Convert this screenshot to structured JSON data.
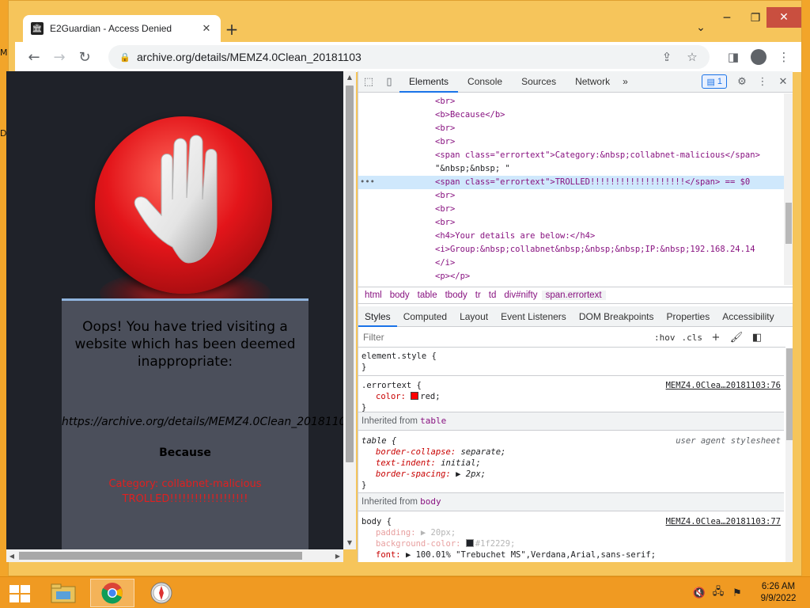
{
  "browser": {
    "tab_title": "E2Guardian - Access Denied",
    "tab_favicon": "museum-icon",
    "url": "archive.org/details/MEMZ4.0Clean_20181103"
  },
  "page": {
    "heading": "Oops! You have tried visiting a website which has been deemed inappropriate:",
    "blocked_url": "https://archive.org/details/MEMZ4.0Clean_20181103",
    "because": "Because",
    "category_line": "Category: collabnet-malicious",
    "reason_line": "TROLLED!!!!!!!!!!!!!!!!!!!"
  },
  "devtools": {
    "tabs": [
      "Elements",
      "Console",
      "Sources",
      "Network"
    ],
    "more_tabs": "»",
    "issues_count": "1",
    "elements": [
      "<br>",
      "<b>Because</b>",
      "<br>",
      "<br>",
      "<span class=\"errortext\">Category:&nbsp;collabnet-malicious</span>",
      "\"&nbsp;&nbsp; \"",
      "<span class=\"errortext\">TROLLED!!!!!!!!!!!!!!!!!!!</span> == $0",
      "<br>",
      "<br>",
      "<br>",
      "<h4>Your details are below:</h4>",
      "<i>Group:&nbsp;collabnet&nbsp;&nbsp;&nbsp;IP:&nbsp;192.168.24.14",
      "</i>",
      "<p></p>"
    ],
    "selected_dots": "•••",
    "breadcrumbs": [
      "html",
      "body",
      "table",
      "tbody",
      "tr",
      "td",
      "div#nifty",
      "span.errortext"
    ],
    "sub_tabs": [
      "Styles",
      "Computed",
      "Layout",
      "Event Listeners",
      "DOM Breakpoints",
      "Properties",
      "Accessibility"
    ],
    "filter_placeholder": "Filter",
    "hov": ":hov",
    "cls": ".cls",
    "styles": {
      "element_style_open": "element.style {",
      "close_brace": "}",
      "errortext_selector": ".errortext {",
      "errortext_source": "MEMZ4.0Clea…20181103:76",
      "color_prop": "color:",
      "color_value": "red;",
      "color_swatch": "#ff0000",
      "inherited_from": "Inherited from",
      "inherited_table": "table",
      "table_selector": "table {",
      "table_source": "user agent stylesheet",
      "table_props": [
        {
          "name": "border-collapse:",
          "value": "separate;"
        },
        {
          "name": "text-indent:",
          "value": "initial;"
        },
        {
          "name": "border-spacing:",
          "value": "▶ 2px;"
        }
      ],
      "inherited_body": "body",
      "body_selector": "body {",
      "body_source": "MEMZ4.0Clea…20181103:77",
      "body_props": [
        {
          "name": "padding:",
          "value": "▶ 20px;"
        },
        {
          "name": "background-color:",
          "value": "#1f2229;"
        },
        {
          "name": "font:",
          "value": "▶ 100.01% \"Trebuchet MS\",Verdana,Arial,sans-serif;"
        }
      ],
      "body_swatch": "#1f2229"
    }
  },
  "taskbar": {
    "time": "6:26 AM",
    "date": "9/9/2022",
    "apps": [
      "file-explorer-icon",
      "chrome-icon",
      "safari-compass-icon"
    ]
  },
  "colors": {
    "accent": "#1a73e8",
    "desktop": "#f2a52a",
    "page_bg": "#1f2229",
    "error_text": "#e02020"
  }
}
